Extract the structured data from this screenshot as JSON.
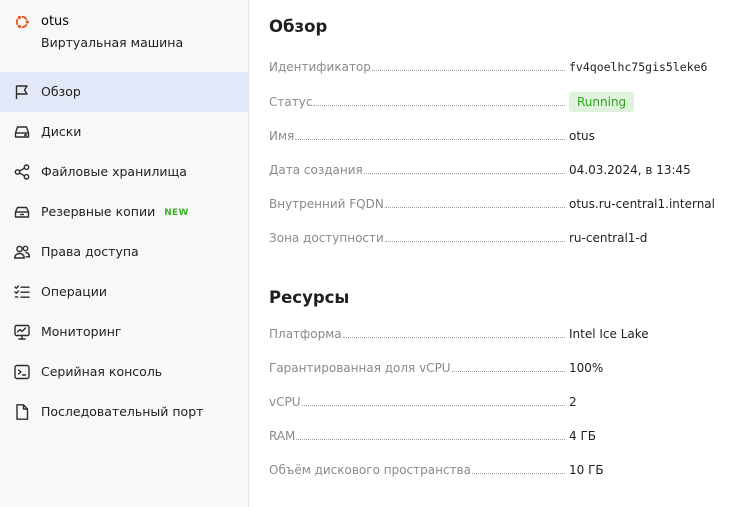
{
  "vm": {
    "name": "otus",
    "type": "Виртуальная машина"
  },
  "sidebar": {
    "items": [
      {
        "label": "Обзор",
        "icon": "flag-icon",
        "active": true
      },
      {
        "label": "Диски",
        "icon": "disk-icon"
      },
      {
        "label": "Файловые хранилища",
        "icon": "share-nodes-icon"
      },
      {
        "label": "Резервные копии",
        "icon": "backup-icon",
        "badge": "NEW"
      },
      {
        "label": "Права доступа",
        "icon": "users-icon"
      },
      {
        "label": "Операции",
        "icon": "checklist-icon"
      },
      {
        "label": "Мониторинг",
        "icon": "monitor-chart-icon"
      },
      {
        "label": "Серийная консоль",
        "icon": "terminal-icon"
      },
      {
        "label": "Последовательный порт",
        "icon": "document-icon"
      }
    ]
  },
  "overview": {
    "title": "Обзор",
    "rows": [
      {
        "key": "Идентификатор",
        "value": "fv4qoelhc75gis5leke6"
      },
      {
        "key": "Статус",
        "value": "Running"
      },
      {
        "key": "Имя",
        "value": "otus"
      },
      {
        "key": "Дата создания",
        "value": "04.03.2024, в 13:45"
      },
      {
        "key": "Внутренний FQDN",
        "value": "otus.ru-central1.internal"
      },
      {
        "key": "Зона доступности",
        "value": "ru-central1-d"
      }
    ]
  },
  "resources": {
    "title": "Ресурсы",
    "rows": [
      {
        "key": "Платформа",
        "value": "Intel Ice Lake"
      },
      {
        "key": "Гарантированная доля vCPU",
        "value": "100%"
      },
      {
        "key": "vCPU",
        "value": "2"
      },
      {
        "key": "RAM",
        "value": "4 ГБ"
      },
      {
        "key": "Объём дискового пространства",
        "value": "10 ГБ"
      }
    ]
  },
  "colors": {
    "accent_active_bg": "#e3e8f8",
    "status_green": "#34a023",
    "badge_new": "#3fae2a",
    "ubuntu_orange": "#e95420"
  }
}
